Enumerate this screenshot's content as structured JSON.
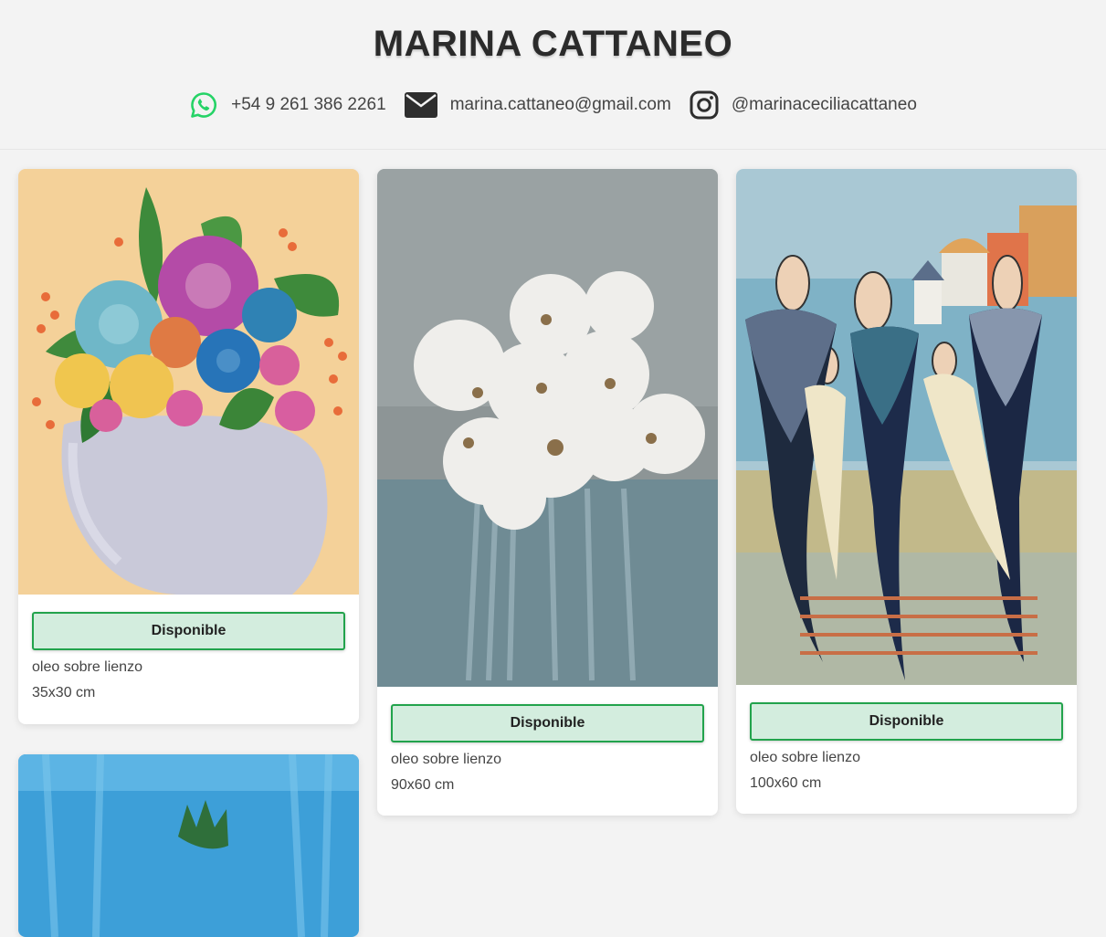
{
  "header": {
    "title": "MARINA CATTANEO",
    "contacts": {
      "whatsapp": "+54 9 261 386 2261",
      "email": "marina.cattaneo@gmail.com",
      "instagram": "@marinaceciliacattaneo"
    }
  },
  "colors": {
    "whatsapp_green": "#25d366",
    "status_bg": "#d3edde",
    "status_border": "#22a34c"
  },
  "artworks": [
    {
      "subject": "flowers-in-vase",
      "status": "Disponible",
      "technique": "oleo sobre lienzo",
      "size": "35x30 cm"
    },
    {
      "subject": "white-flowers",
      "status": "Disponible",
      "technique": "oleo sobre lienzo",
      "size": "90x60 cm"
    },
    {
      "subject": "women-figures-village",
      "status": "Disponible",
      "technique": "oleo sobre lienzo",
      "size": "100x60 cm"
    },
    {
      "subject": "blue-abstract"
    }
  ]
}
